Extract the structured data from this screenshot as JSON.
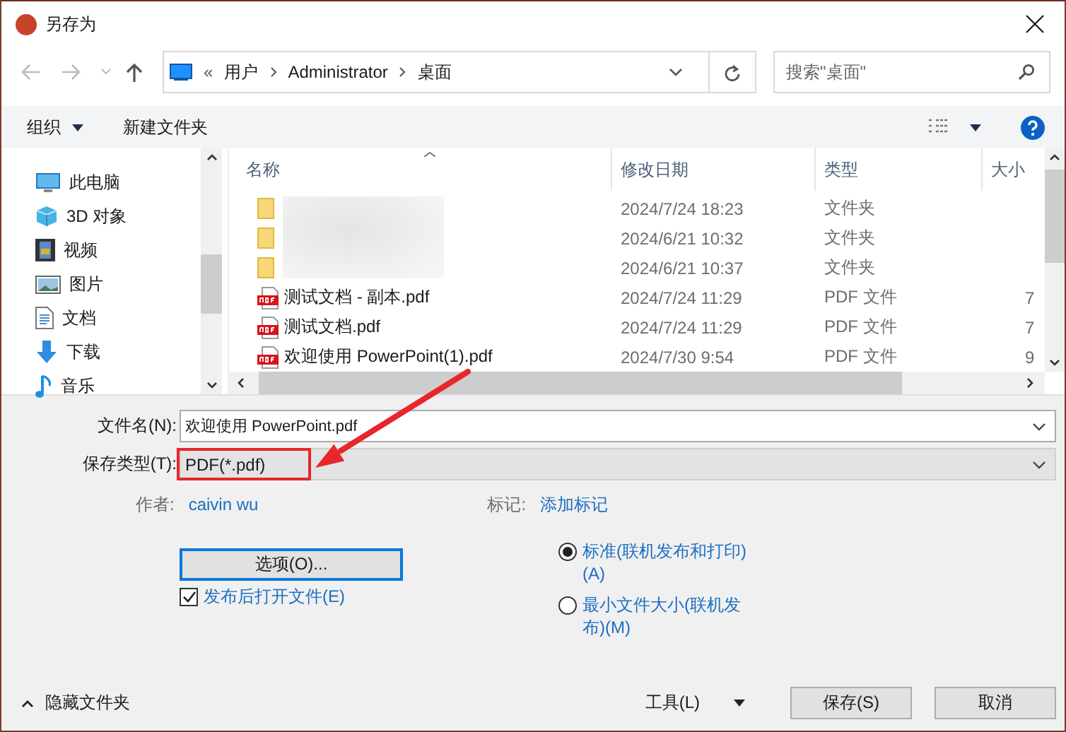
{
  "window": {
    "title": "另存为"
  },
  "address": {
    "prefix": "«",
    "crumbs": [
      "用户",
      "Administrator",
      "桌面"
    ]
  },
  "search": {
    "placeholder": "搜索\"桌面\""
  },
  "toolbar": {
    "organize": "组织",
    "new_folder": "新建文件夹"
  },
  "nav": [
    {
      "label": "此电脑",
      "kind": "pc"
    },
    {
      "label": "3D 对象",
      "kind": "cube"
    },
    {
      "label": "视频",
      "kind": "video"
    },
    {
      "label": "图片",
      "kind": "image"
    },
    {
      "label": "文档",
      "kind": "doc"
    },
    {
      "label": "下载",
      "kind": "download"
    },
    {
      "label": "音乐",
      "kind": "music"
    }
  ],
  "table": {
    "columns": [
      "名称",
      "修改日期",
      "类型",
      "大小"
    ],
    "rows": [
      {
        "kind": "folder",
        "date": "2024/7/24 18:23",
        "type": "文件夹"
      },
      {
        "kind": "folder",
        "date": "2024/6/21 10:32",
        "type": "文件夹"
      },
      {
        "kind": "folder",
        "date": "2024/6/21 10:37",
        "type": "文件夹"
      },
      {
        "kind": "pdf",
        "name": "测试文档 - 副本.pdf",
        "date": "2024/7/24 11:29",
        "type": "PDF 文件",
        "size": "7"
      },
      {
        "kind": "pdf",
        "name": "测试文档.pdf",
        "date": "2024/7/24 11:29",
        "type": "PDF 文件",
        "size": "7"
      },
      {
        "kind": "pdf",
        "name": "欢迎使用 PowerPoint(1).pdf",
        "date": "2024/7/30 9:54",
        "type": "PDF 文件",
        "size": "9"
      }
    ]
  },
  "filename": {
    "label": "文件名(N):",
    "value": "欢迎使用 PowerPoint.pdf"
  },
  "filetype": {
    "label": "保存类型(T):",
    "value": "PDF(*.pdf)"
  },
  "meta": {
    "author_label": "作者:",
    "author": "caivin wu",
    "tags_label": "标记:",
    "tags": "添加标记"
  },
  "options_button": "选项(O)...",
  "open_after": {
    "label": "发布后打开文件(E)",
    "checked": true
  },
  "optimize": [
    {
      "label": "标准(联机发布和打印)(A)",
      "selected": true
    },
    {
      "label": "最小文件大小(联机发布)(M)",
      "selected": false
    }
  ],
  "footer": {
    "hide_folders": "隐藏文件夹",
    "tools": "工具(L)",
    "save": "保存(S)",
    "cancel": "取消"
  }
}
